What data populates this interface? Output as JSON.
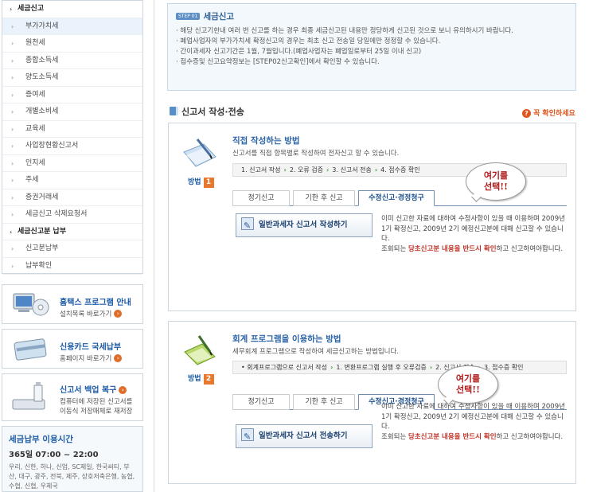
{
  "sidebar": {
    "items": [
      {
        "label": "세금신고",
        "kind": "sec"
      },
      {
        "label": "부가가치세",
        "kind": "sub",
        "selected": true
      },
      {
        "label": "원천세",
        "kind": "sub"
      },
      {
        "label": "종합소득세",
        "kind": "sub"
      },
      {
        "label": "양도소득세",
        "kind": "sub"
      },
      {
        "label": "증여세",
        "kind": "sub"
      },
      {
        "label": "개별소비세",
        "kind": "sub"
      },
      {
        "label": "교육세",
        "kind": "sub"
      },
      {
        "label": "사업장현황신고서",
        "kind": "sub"
      },
      {
        "label": "인지세",
        "kind": "sub"
      },
      {
        "label": "주세",
        "kind": "sub"
      },
      {
        "label": "증권거래세",
        "kind": "sub"
      },
      {
        "label": "세금신고 삭제요청서",
        "kind": "sub"
      },
      {
        "label": "세금신고분 납부",
        "kind": "sec"
      },
      {
        "label": "신고분납부",
        "kind": "sub"
      },
      {
        "label": "납부확인",
        "kind": "sub"
      }
    ]
  },
  "promos": {
    "program": {
      "title": "홈택스 프로그램 안내",
      "sub": "설치목록 바로가기"
    },
    "card": {
      "title": "신용카드 국세납부",
      "sub": "홈페이지 바로가기"
    },
    "backup": {
      "title": "신고서 백업 복구",
      "sub1": "컴퓨터에 저장된 신고서를",
      "sub2": "이동식 저장매체로 재저장"
    }
  },
  "payment_hours": {
    "title": "세금납부 이용시간",
    "time": "365일 07:00 ~ 22:00",
    "banks": "우리, 신한, 하나, 신업, SC제일, 한국씨티, 부산, 대구, 광주, 전북, 제주, 상호저축은행, 농협, 수협, 신협, 우체국"
  },
  "notice": {
    "step": "STEP 01",
    "title": "세금신고",
    "items": [
      "해당 신고기한내 여러 번 신고를 하는 경우 최종 세금신고된 내용만 정당하게 신고된 것으로 보니 유의하시기 바랍니다.",
      "폐업사업자의 부가가치세 확정신고의 경우는 최초 신고 전송일 당일에만 정정할 수 있습니다.",
      "간이과세자 신고기간은 1월, 7월입니다.(폐업사업자는 폐업일로부터 25일 이내 신고)",
      "접수증및 신고요약정보는 [STEP02신고확인]에서 확인할 수 있습니다."
    ]
  },
  "section": {
    "title": "신고서 작성·전송",
    "confirm": "꼭 확인하세요"
  },
  "method1": {
    "label": "방법",
    "num": "1",
    "title": "직접 작성하는 방법",
    "desc": "신고서를 직접 항목별로 작성하여 전자신고 할 수 있습니다.",
    "steps": [
      "1. 신고서 작성",
      "2. 오류 검증",
      "3. 신고서 전송",
      "4. 접수증 확인"
    ],
    "tabs": [
      "정기신고",
      "기한 후 신고",
      "수정신고·경정청구"
    ],
    "button": "일반과세자 신고서 작성하기",
    "info_a": "이미 신고한 자료에 대하여 수정사항이 있을 때 이용하며 2009년 1기 확정신고, 2009년 2기 예정신고분에 대해 신고할 수 있습니다.",
    "info_b1": "조회되는 ",
    "info_red": "당초신고분 내용을 반드시 확인",
    "info_b2": "하고 신고하여야합니다."
  },
  "method2": {
    "label": "방법",
    "num": "2",
    "title": "회계 프로그램을 이용하는 방법",
    "desc": "세무회계 프로그램으로 작성하여 세금신고하는 방법입니다.",
    "steps": [
      "• 회계프로그램으로 신고서 작성",
      "1. 변환프로그램 실행 후 오류검증",
      "2. 신고서 전송",
      "3. 접수증 확인"
    ],
    "tabs": [
      "정기신고",
      "기한 후 신고",
      "수정신고·경정청구"
    ],
    "button": "일반과세자 신고서 전송하기",
    "info_a": "이미 신고한 자료에 대하여 수정사항이 있을 때 이용하며 2009년 1기 확정신고, 2009년 2기 예정신고분에 대해 신고할 수 있습니다.",
    "info_b1": "조회되는 ",
    "info_red": "당초신고분 내용을 반드시 확인",
    "info_b2": "하고 신고하여야합니다."
  },
  "annotations": {
    "line1": "여기를",
    "line2": "선택!!"
  },
  "colors": {
    "accent": "#1b5aa6",
    "highlight": "#e0561f",
    "annotation": "#b01818",
    "tab_active": "#1b4f8f"
  }
}
